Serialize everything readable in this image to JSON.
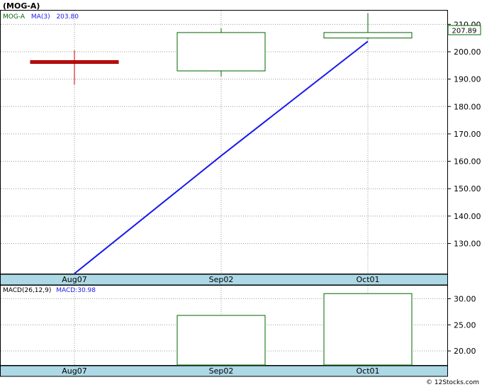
{
  "title": "(MOG-A)",
  "colors": {
    "up": "#006400",
    "down": "#cc0000",
    "ma_line": "#1a1aee",
    "axis_bar": "#add8e6",
    "grid": "#999999",
    "price_box": "#006400"
  },
  "chart_data": [
    {
      "type": "candlestick",
      "legend": {
        "symbol": "MOG-A",
        "ma_label": "MA(3)",
        "ma_value": "203.80"
      },
      "last_price_label": "207.89",
      "x_labels": [
        "Aug07",
        "Sep02",
        "Oct01"
      ],
      "ylim": [
        119,
        215
      ],
      "y_ticks": [
        130,
        140,
        150,
        160,
        170,
        180,
        190,
        200,
        210
      ],
      "candles": [
        {
          "x": "Aug07",
          "open": 196.5,
          "close": 195.7,
          "high": 200.5,
          "low": 188.0
        },
        {
          "x": "Sep02",
          "open": 193.0,
          "close": 207.0,
          "high": 208.5,
          "low": 191.0
        },
        {
          "x": "Oct01",
          "open": 205.0,
          "close": 207.0,
          "high": 214.0,
          "low": 204.5
        }
      ],
      "ma": [
        {
          "x": "Aug07",
          "value": 119.0
        },
        {
          "x": "Sep02",
          "value": 162.0
        },
        {
          "x": "Oct01",
          "value": 203.8
        }
      ]
    },
    {
      "type": "bar",
      "legend": {
        "label": "MACD(26,12,9)",
        "value_label": "MACD:30.98"
      },
      "categories": [
        "Sep02",
        "Oct01"
      ],
      "values": [
        26.8,
        30.98
      ],
      "ylim": [
        17.3,
        32.5
      ],
      "y_ticks": [
        20,
        25,
        30
      ],
      "x_labels": [
        "Aug07",
        "Sep02",
        "Oct01"
      ]
    }
  ],
  "watermark": "© 12Stocks.com"
}
